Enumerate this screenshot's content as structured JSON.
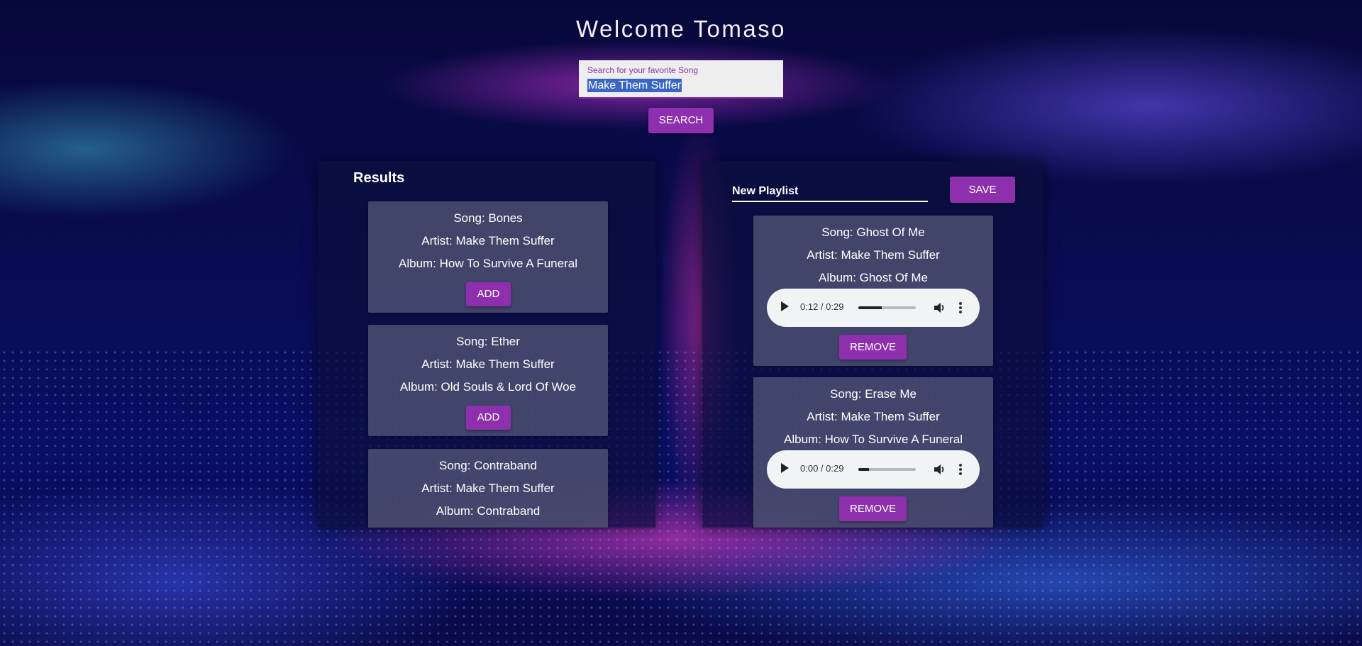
{
  "header": {
    "title": "Welcome Tomaso"
  },
  "search": {
    "label": "Search for your favorite Song",
    "value": "Make Them Suffer",
    "button_label": "SEARCH"
  },
  "results": {
    "title": "Results",
    "add_label": "ADD",
    "items": [
      {
        "song": "Song: Bones",
        "artist": "Artist: Make Them Suffer",
        "album": "Album: How To Survive A Funeral"
      },
      {
        "song": "Song: Ether",
        "artist": "Artist: Make Them Suffer",
        "album": "Album: Old Souls & Lord Of Woe"
      },
      {
        "song": "Song: Contraband",
        "artist": "Artist: Make Them Suffer",
        "album": "Album: Contraband"
      }
    ]
  },
  "playlist": {
    "name": "New Playlist",
    "save_label": "SAVE",
    "remove_label": "REMOVE",
    "items": [
      {
        "song": "Song: Ghost Of Me",
        "artist": "Artist: Make Them Suffer",
        "album": "Album: Ghost Of Me",
        "time": "0:12 / 0:29",
        "progress": 0.41
      },
      {
        "song": "Song: Erase Me",
        "artist": "Artist: Make Them Suffer",
        "album": "Album: How To Survive A Funeral",
        "time": "0:00 / 0:29",
        "progress": 0.18
      }
    ]
  },
  "colors": {
    "accent": "#8e2fae",
    "card": "#555878"
  }
}
